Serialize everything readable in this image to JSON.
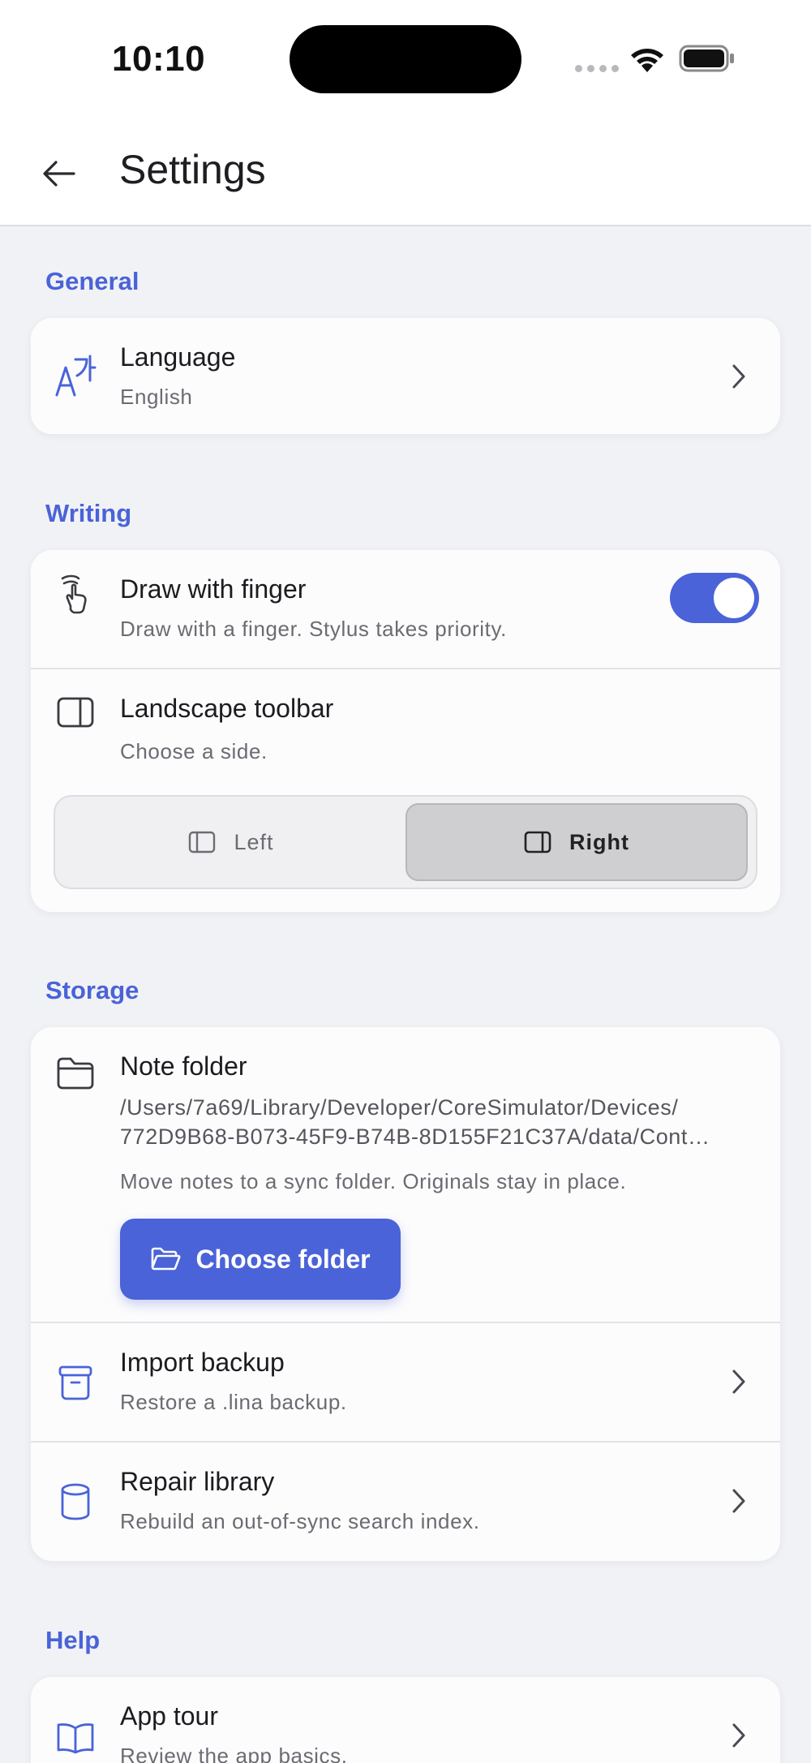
{
  "status_bar": {
    "time": "10:10"
  },
  "header": {
    "title": "Settings"
  },
  "sections": {
    "general": {
      "label": "General",
      "language": {
        "title": "Language",
        "value": "English"
      }
    },
    "writing": {
      "label": "Writing",
      "draw_with_finger": {
        "title": "Draw with finger",
        "subtitle": "Draw with a finger. Stylus takes priority.",
        "enabled": true
      },
      "landscape_toolbar": {
        "title": "Landscape toolbar",
        "subtitle": "Choose a side.",
        "options": [
          "Left",
          "Right"
        ],
        "selected": "Right"
      }
    },
    "storage": {
      "label": "Storage",
      "note_folder": {
        "title": "Note folder",
        "path_line1": "/Users/7a69/Library/Developer/CoreSimulator/Devices/",
        "path_line2": "772D9B68-B073-45F9-B74B-8D155F21C37A/data/Cont…",
        "hint": "Move notes to a sync folder. Originals stay in place.",
        "button": "Choose folder"
      },
      "import_backup": {
        "title": "Import backup",
        "subtitle": "Restore a .lina backup."
      },
      "repair_library": {
        "title": "Repair library",
        "subtitle": "Rebuild an out-of-sync search index."
      }
    },
    "help": {
      "label": "Help",
      "app_tour": {
        "title": "App tour",
        "subtitle": "Review the app basics."
      }
    }
  },
  "icons": {
    "back": "arrow-left-icon",
    "language": "translate-icon",
    "draw": "hand-pointer-icon",
    "toolbar": "sidebar-panel-icon",
    "folder": "folder-icon",
    "archive": "archive-box-icon",
    "database": "database-icon",
    "book": "open-book-icon",
    "chevron": "chevron-right-icon"
  },
  "colors": {
    "accent": "#4a63d8",
    "background": "#f1f2f5",
    "card": "#fcfcfd"
  }
}
